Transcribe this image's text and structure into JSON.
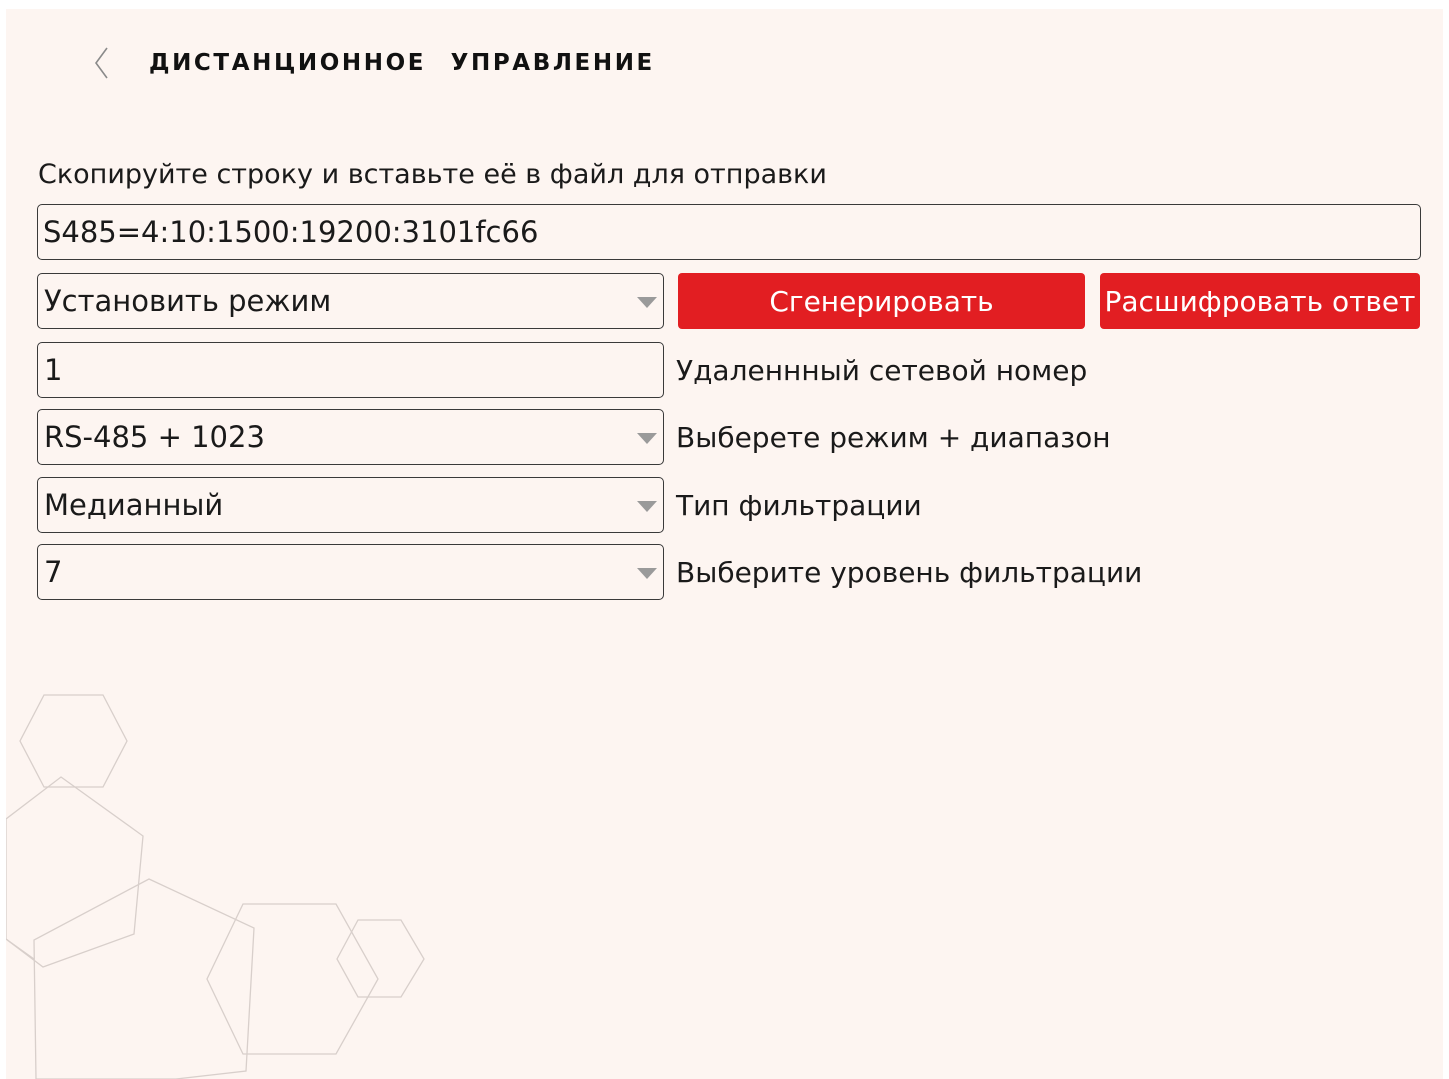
{
  "header": {
    "title": "ДИСТАНЦИОННОЕ УПРАВЛЕНИЕ"
  },
  "instruction": "Скопируйте строку и вставьте её в файл для отправки",
  "command_string": "S485=4:10:1500:19200:3101fc66",
  "action_select": {
    "value": "Установить режим"
  },
  "buttons": {
    "generate": "Сгенерировать",
    "decode": "Расшифровать ответ"
  },
  "fields": {
    "network_number": {
      "value": "1",
      "label": "Удаленнный сетевой номер"
    },
    "mode_range": {
      "value": "RS-485 + 1023",
      "label": "Выберете режим + диапазон"
    },
    "filter_type": {
      "value": "Медианный",
      "label": "Тип фильтрации"
    },
    "filter_level": {
      "value": "7",
      "label": "Выберите уровень фильтрации"
    }
  },
  "colors": {
    "background": "#fdf5f1",
    "accent": "#e21e22",
    "border": "#3a3a3a",
    "dropdown_arrow": "#9a9a9a"
  },
  "icons": {
    "back": "chevron-left-icon",
    "dropdown": "triangle-down-icon",
    "background_decoration": "hexagon-outline-pattern"
  }
}
